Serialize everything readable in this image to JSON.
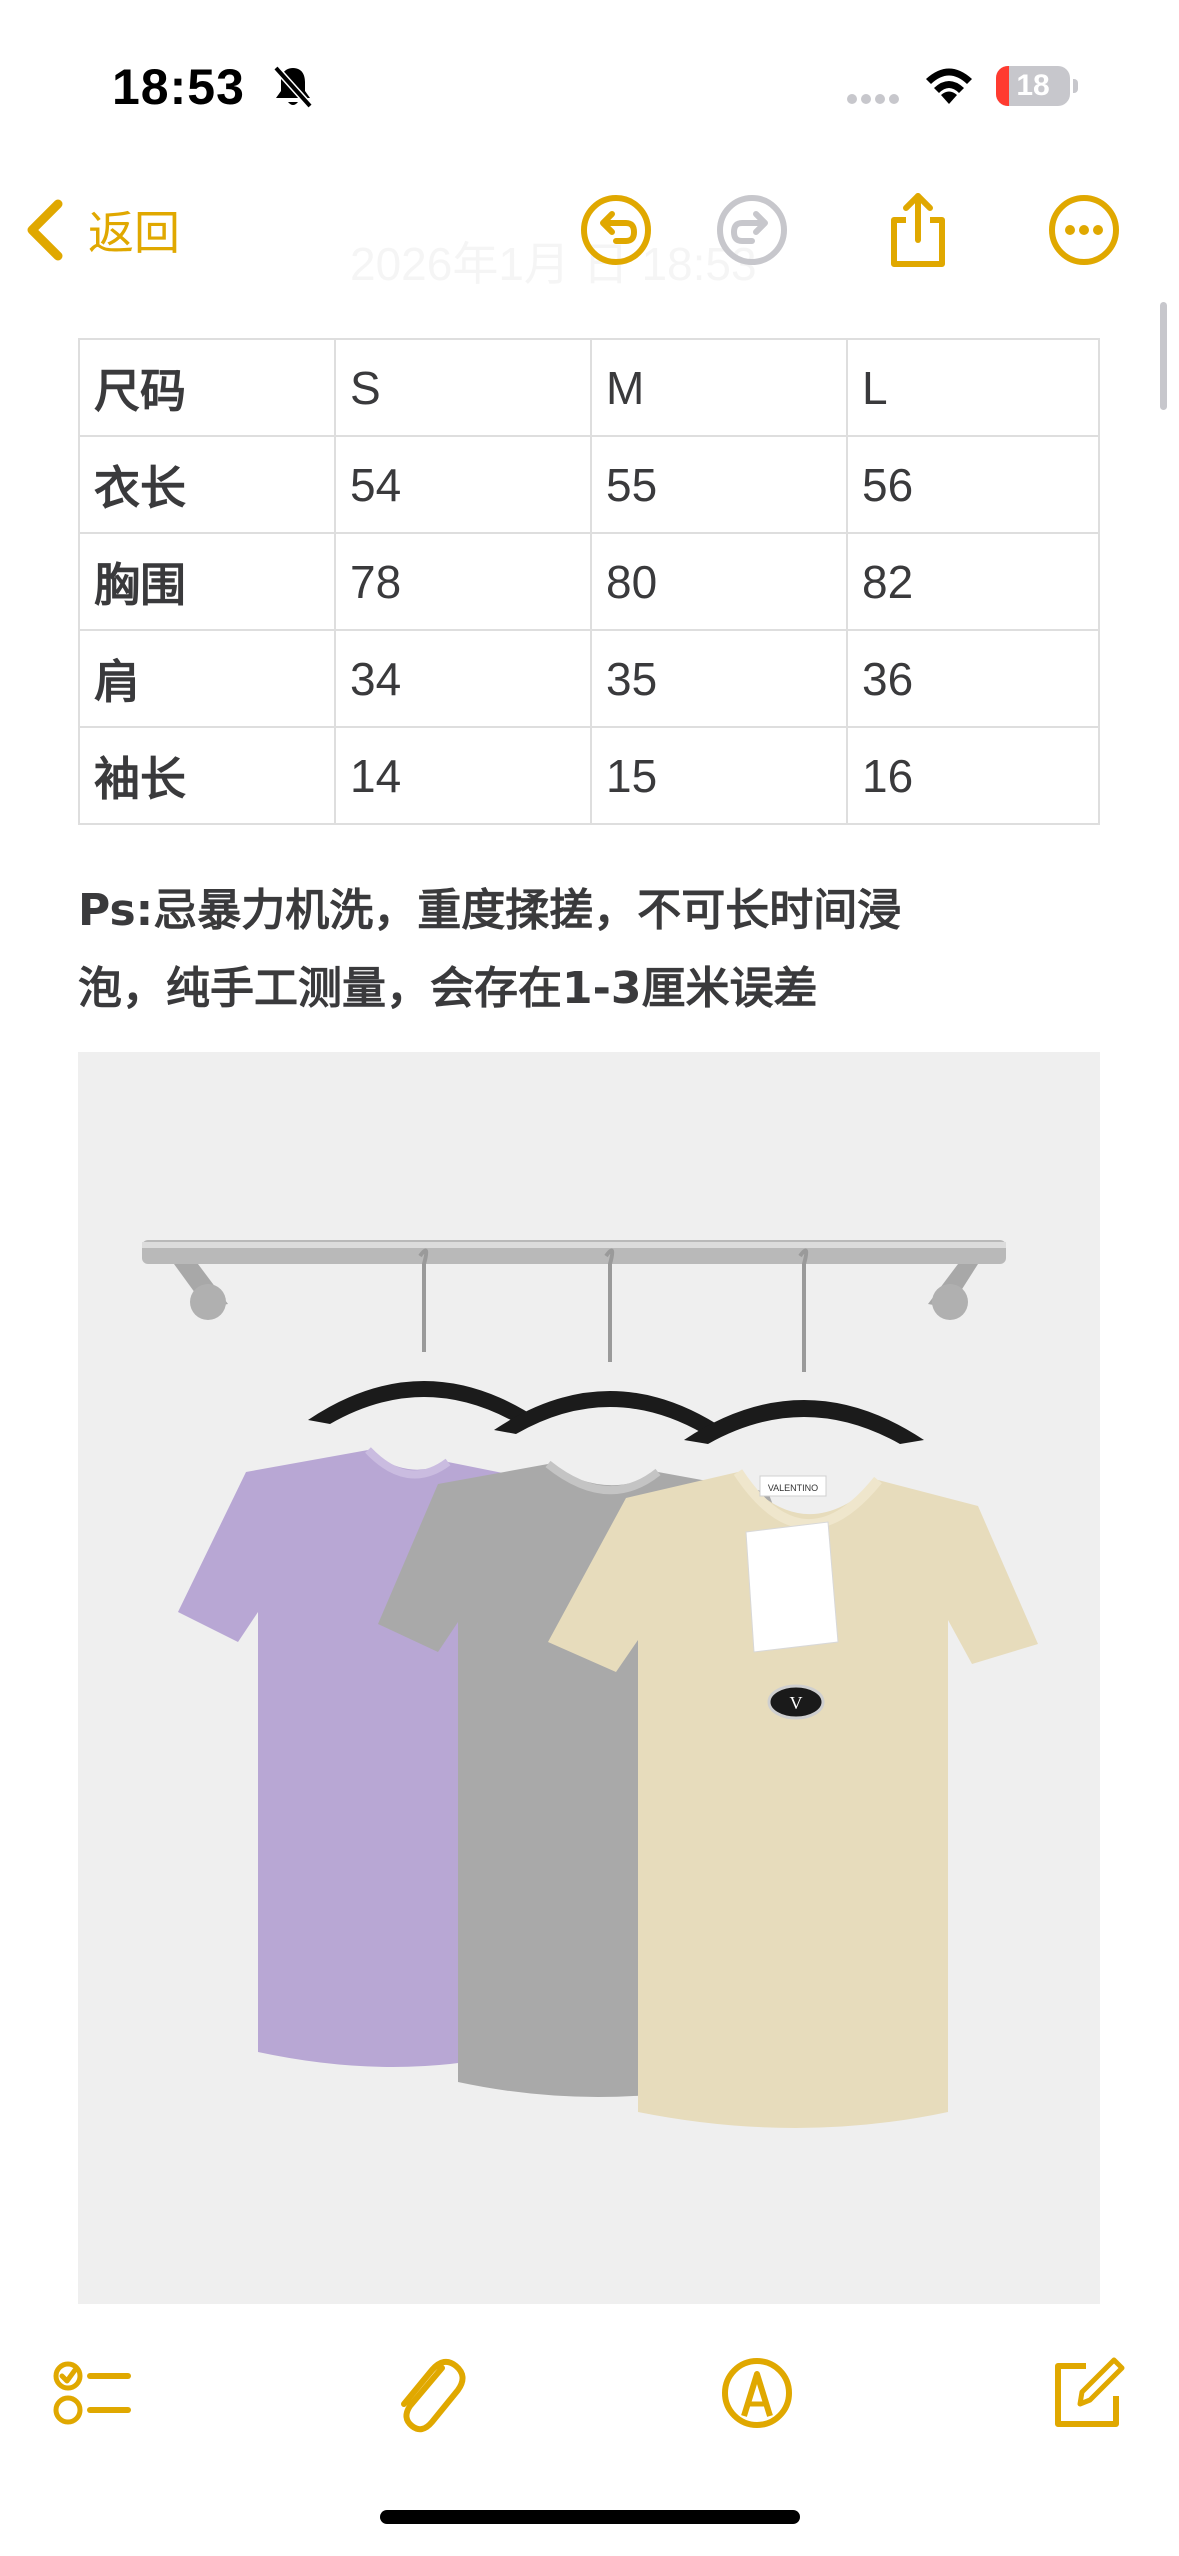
{
  "status_bar": {
    "time": "18:53",
    "battery_level": "18",
    "battery_fraction": 0.18,
    "colors": {
      "battery_low": "#ff3b30"
    }
  },
  "nav": {
    "back_label": "返回",
    "faded_date": "2026年1月 日 18:53",
    "icons": [
      "chevron-left-icon",
      "undo-icon",
      "redo-icon",
      "share-icon",
      "more-icon"
    ],
    "accent_color": "#e0a800"
  },
  "table": {
    "rows": [
      [
        "尺码",
        "S",
        "M",
        "L"
      ],
      [
        "衣长",
        "54",
        "55",
        "56"
      ],
      [
        "胸围",
        "78",
        "80",
        "82"
      ],
      [
        "肩",
        "34",
        "35",
        "36"
      ],
      [
        "袖长",
        "14",
        "15",
        "16"
      ]
    ]
  },
  "note": {
    "line1": "Ps:忌暴力机洗，重度揉搓，不可长时间浸",
    "line2": "泡，纯手工测量，会存在1-3厘米误差"
  },
  "photo": {
    "tag_brand": "VALENTINO",
    "logo_letters": "VLogo"
  },
  "toolbar": {
    "icons": [
      "checklist-icon",
      "paperclip-icon",
      "markup-pen-icon",
      "compose-icon"
    ]
  }
}
